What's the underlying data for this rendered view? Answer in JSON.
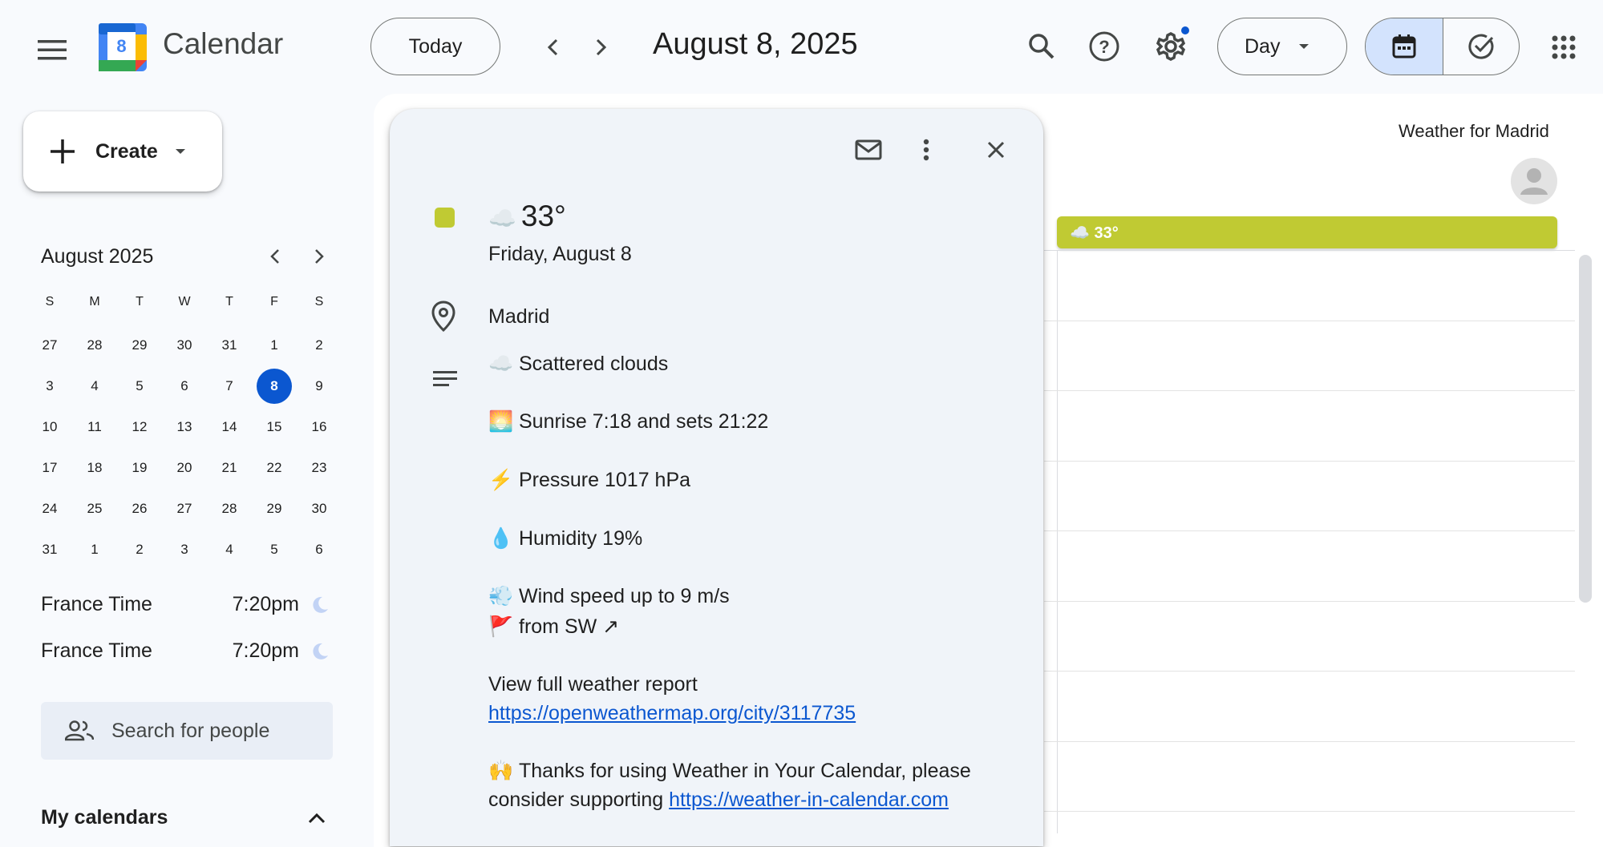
{
  "header": {
    "app_name": "Calendar",
    "logo_day": "8",
    "today_button": "Today",
    "date_title": "August 8, 2025",
    "view_select": "Day"
  },
  "sidebar": {
    "create_label": "Create",
    "mini_calendar": {
      "month_label": "August 2025",
      "weekdays": [
        "S",
        "M",
        "T",
        "W",
        "T",
        "F",
        "S"
      ],
      "weeks": [
        [
          "27",
          "28",
          "29",
          "30",
          "31",
          "1",
          "2"
        ],
        [
          "3",
          "4",
          "5",
          "6",
          "7",
          "8",
          "9"
        ],
        [
          "10",
          "11",
          "12",
          "13",
          "14",
          "15",
          "16"
        ],
        [
          "17",
          "18",
          "19",
          "20",
          "21",
          "22",
          "23"
        ],
        [
          "24",
          "25",
          "26",
          "27",
          "28",
          "29",
          "30"
        ],
        [
          "31",
          "1",
          "2",
          "3",
          "4",
          "5",
          "6"
        ]
      ],
      "selected_day": "8"
    },
    "timezones": [
      {
        "label": "France Time",
        "time": "7:20pm"
      },
      {
        "label": "France Time",
        "time": "7:20pm"
      }
    ],
    "search_people_placeholder": "Search for people",
    "my_calendars_label": "My calendars"
  },
  "main": {
    "column_label": "Weather for Madrid",
    "allday_event": "☁️ 33°"
  },
  "popup": {
    "color": "#c0ca33",
    "title_emoji": "☁️",
    "title": "33°",
    "date": "Friday, August 8",
    "location": "Madrid",
    "description": {
      "conditions_emoji": "☁️",
      "conditions": "Scattered clouds",
      "sunrise_emoji": "🌅",
      "sunrise": "Sunrise 7:18 and sets 21:22",
      "pressure_emoji": "⚡",
      "pressure": "Pressure 1017 hPa",
      "humidity_emoji": "💧",
      "humidity": "Humidity 19%",
      "wind_emoji": "💨",
      "wind": "Wind speed up to 9 m/s",
      "direction_emoji": "🚩",
      "direction": "from SW ↗",
      "report_label": "View full weather report",
      "report_link": "https://openweathermap.org/city/3117735",
      "thanks_emoji": "🙌",
      "thanks_line1": "Thanks for using Weather in Your Calendar, please",
      "thanks_line2_prefix": "consider supporting",
      "thanks_link": "https://weather-in-calendar.com"
    }
  },
  "colors": {
    "accent": "#0b57d0",
    "event_green": "#c0ca33",
    "selected_view": "#d3e3fd"
  }
}
